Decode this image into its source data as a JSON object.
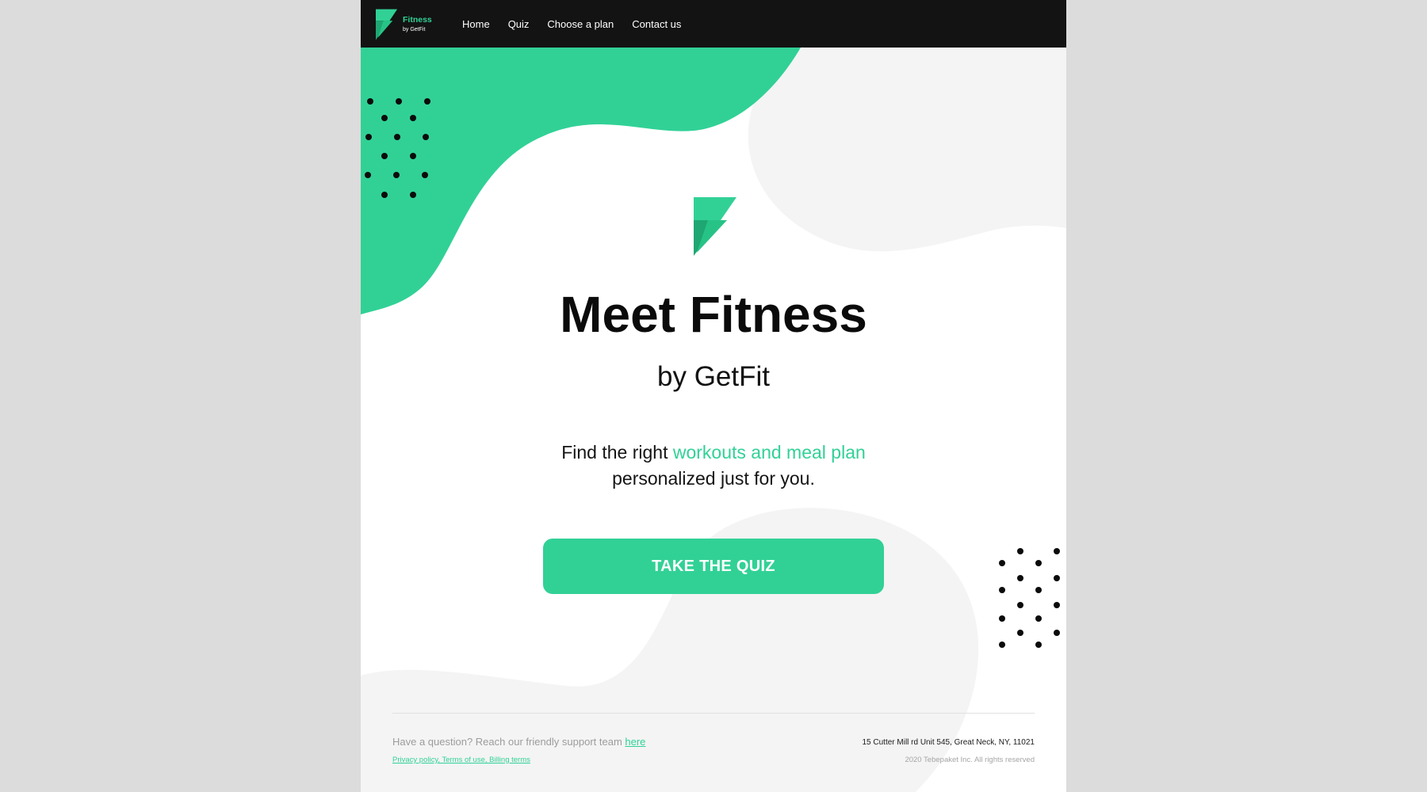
{
  "nav": {
    "brand": "Fitness",
    "brand_sub": "by GetFit",
    "links": [
      "Home",
      "Quiz",
      "Choose a plan",
      "Contact us"
    ]
  },
  "hero": {
    "title": "Meet Fitness",
    "subtitle": "by GetFit",
    "tagline_before": "Find the right ",
    "tagline_accent": "workouts and meal plan",
    "tagline_after": "personalized just for you.",
    "cta_label": "TAKE THE QUIZ"
  },
  "footer": {
    "question": "Have a question? Reach our friendly support team ",
    "question_link": "here",
    "legal_links": "Privacy policy, Terms of use, Billing terms",
    "address": "15 Cutter Mill rd Unit 545, Great Neck, NY, 11021",
    "copyright": "2020 Tebepaket Inc. All rights reserved"
  },
  "colors": {
    "accent": "#31d196",
    "navbar": "#131313",
    "blob_gray": "#f4f4f4"
  },
  "icons": [
    "fitness-logo-icon",
    "dot-pattern"
  ]
}
